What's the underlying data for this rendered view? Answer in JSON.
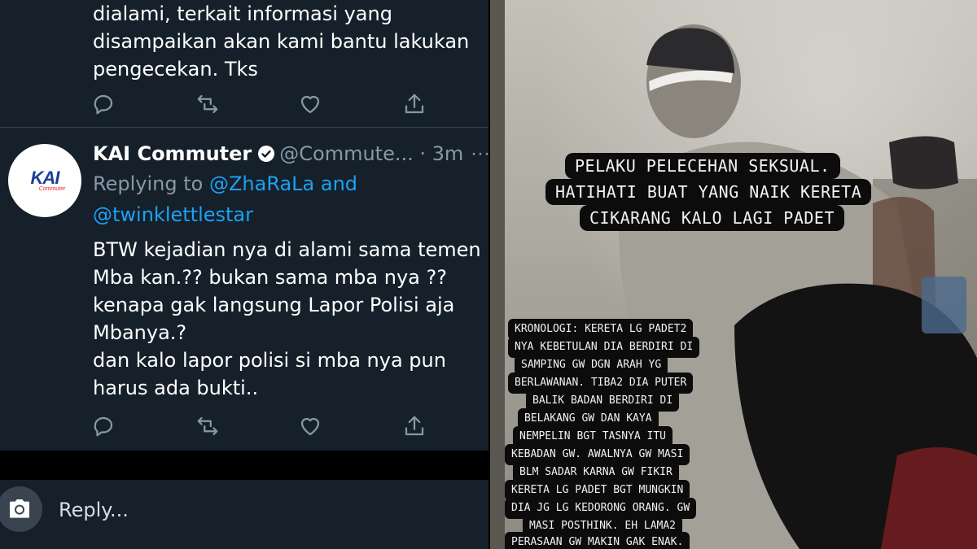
{
  "tweet_top": {
    "lines": [
      "dialami, terkait informasi yang",
      "disampaikan akan kami bantu lakukan",
      "pengecekan. Tks"
    ]
  },
  "tweet": {
    "display_name": "KAI Commuter",
    "handle": "@Commute...",
    "time": "· 3m",
    "more": "···",
    "avatar": {
      "brand": "KAI",
      "sub": "Commuter"
    },
    "replying_prefix": "Replying to",
    "mention1": "@ZhaRaLa",
    "and": "and",
    "mention2": "@twinklettlestar",
    "lines": [
      "BTW kejadian nya di alami sama temen",
      "Mba kan.?? bukan sama mba nya ??",
      "kenapa gak langsung Lapor Polisi aja",
      "Mbanya.?",
      "dan kalo lapor polisi si mba nya pun",
      "harus ada bukti.."
    ]
  },
  "actions": [
    "reply-icon",
    "retweet-icon",
    "like-icon",
    "share-icon"
  ],
  "composer": {
    "placeholder": "Reply...",
    "icon": "camera-icon"
  },
  "story": {
    "caption_title": [
      "PELAKU PELECEHAN SEKSUAL.",
      "HATIHATI BUAT YANG NAIK KERETA",
      "CIKARANG KALO LAGI PADET"
    ],
    "caption_body": [
      "KRONOLOGI: KERETA LG PADET2",
      "NYA KEBETULAN DIA BERDIRI DI",
      "SAMPING GW DGN ARAH YG",
      "BERLAWANAN. TIBA2 DIA PUTER",
      "BALIK BADAN BERDIRI DI",
      "BELAKANG GW DAN KAYA",
      "NEMPELIN BGT TASNYA ITU",
      "KEBADAN GW. AWALNYA GW MASI",
      "BLM SADAR KARNA GW FIKIR",
      "KERETA LG PADET BGT MUNGKIN",
      "DIA JG LG KEDORONG ORANG. GW",
      "MASI POSTHINK. EH LAMA2",
      "PERASAAN GW MAKIN GAK ENAK."
    ]
  },
  "colors": {
    "bg": "#15202b",
    "text": "#ffffff",
    "muted": "#8899a6",
    "link": "#1da1f2",
    "verified": "#ffffff"
  }
}
